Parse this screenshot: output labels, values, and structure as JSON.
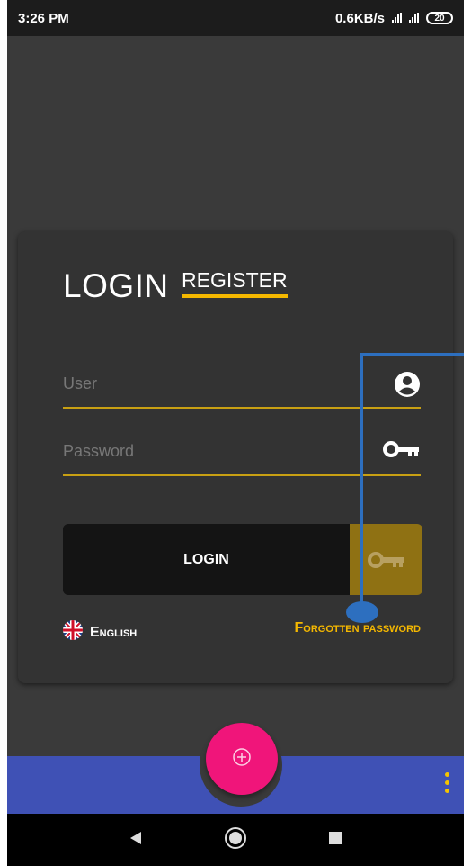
{
  "status_bar": {
    "time": "3:26 PM",
    "speed": "0.6KB/s",
    "network_type": "4G",
    "battery": "20"
  },
  "tabs": {
    "login": "LOGIN",
    "register": "REGISTER"
  },
  "form": {
    "user_placeholder": "User",
    "password_placeholder": "Password",
    "login_button": "LOGIN"
  },
  "footer_links": {
    "language": "English",
    "forgot_password": "Forgotten password"
  },
  "icons": {
    "user": "account-circle-icon",
    "key": "key-icon",
    "flag": "uk-flag-icon",
    "fab": "add-circle-icon",
    "menu": "more-vert-icon"
  },
  "colors": {
    "accent": "#f5b800",
    "background": "#3a3a3a",
    "card": "#333333",
    "bottom_bar": "#3f51b5",
    "fab": "#f0157a",
    "annotation": "#2d6fbf"
  }
}
